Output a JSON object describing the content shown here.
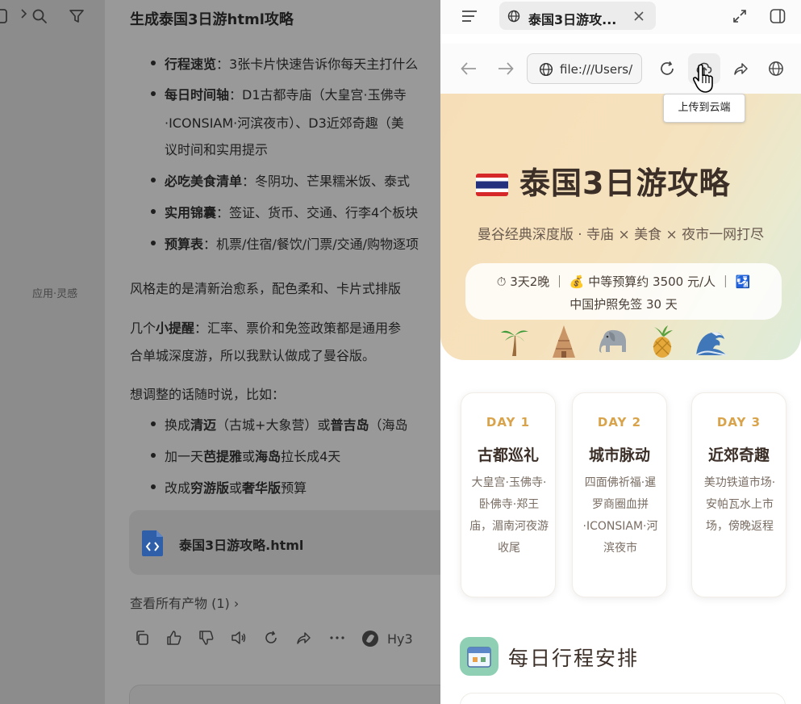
{
  "sidebar": {
    "label": "应用·灵感"
  },
  "chat": {
    "title": "生成泰国3日游html攻略",
    "bullets": [
      {
        "bold": "行程速览",
        "text": "：3张卡片快速告诉你每天主打什么"
      },
      {
        "bold": "每日时间轴",
        "text": "：D1古都寺庙（大皇宫·玉佛寺"
      },
      {
        "bold": "必吃美食清单",
        "text": "：冬阴功、芒果糯米饭、泰式"
      },
      {
        "bold": "实用锦囊",
        "text": "：签证、货币、交通、行李4个板块"
      },
      {
        "bold": "预算表",
        "text": "：机票/住宿/餐饮/门票/交通/购物逐项"
      }
    ],
    "bullet2_line2": "·ICONSIAM·河滨夜市）、D3近郊奇趣（美",
    "bullet2_line3": "议时间和实用提示",
    "para1": "风格走的是清新治愈系，配色柔和、卡片式排版",
    "para2_a": "几个",
    "para2_bold": "小提醒",
    "para2_b": "：汇率、票价和免签政策都是通用参",
    "para2_line2": "合单城深度游，所以我默认做成了曼谷版。",
    "para3": "想调整的话随时说，比如：",
    "sugg1_a": "换成",
    "sugg1_b": "清迈",
    "sugg1_c": "（古城+大象营）或",
    "sugg1_d": "普吉岛",
    "sugg1_e": "（海岛",
    "sugg2_a": "加一天",
    "sugg2_b": "芭提雅",
    "sugg2_c": "或",
    "sugg2_d": "海岛",
    "sugg2_e": "拉长成4天",
    "sugg3_a": "改成",
    "sugg3_b": "穷游版",
    "sugg3_c": "或",
    "sugg3_d": "奢华版",
    "sugg3_e": "预算",
    "file_name": "泰国3日游攻略.html",
    "artifacts_link": "查看所有产物 (1)",
    "model": "Hy3"
  },
  "browser": {
    "tab_title": "泰国3日游攻...",
    "url": "file:///Users/",
    "tooltip": "上传到云端"
  },
  "page": {
    "title": "泰国3日游攻略",
    "subtitle": "曼谷经典深度版 · 寺庙 × 美食 × 夜市一网打尽",
    "pill_line1": "⏱ 3天2晚 ｜ 💰 中等预算约 3500 元/人 ｜ 🛂",
    "pill_line2": "中国护照免签 30 天",
    "days": [
      {
        "label": "DAY 1",
        "title": "古都巡礼",
        "desc": "大皇宫·玉佛寺·卧佛寺·郑王庙，湄南河夜游收尾"
      },
      {
        "label": "DAY 2",
        "title": "城市脉动",
        "desc": "四面佛祈福·暹罗商圈血拼·ICONSIAM·河滨夜市"
      },
      {
        "label": "DAY 3",
        "title": "近郊奇趣",
        "desc": "美功铁道市场·安帕瓦水上市场，傍晚返程"
      }
    ],
    "section_title": "每日行程安排"
  },
  "colors": {
    "accent_gold": "#d8a34a",
    "title_brown": "#3b2f28",
    "overlay_gray": "#999999"
  }
}
